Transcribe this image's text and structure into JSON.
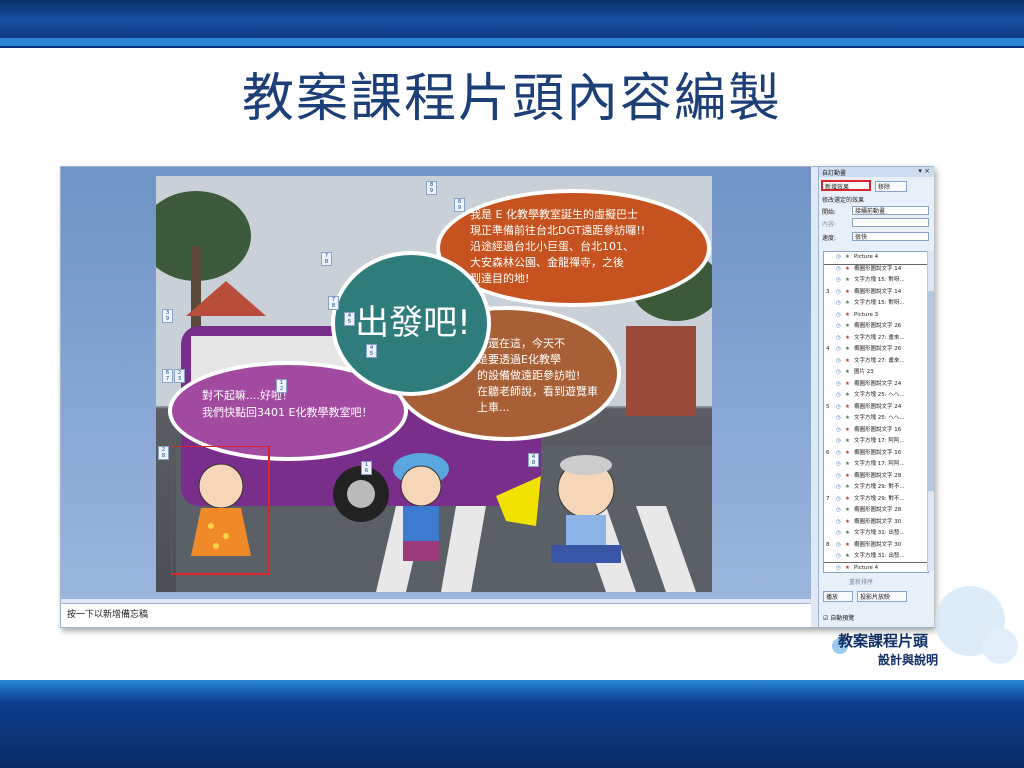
{
  "title": "教案課程片頭內容編製",
  "notes_placeholder": "按一下以新增備忘稿",
  "panel": {
    "header": "自訂動畫",
    "close": "▾ ×",
    "add_effect": "新增效果",
    "remove": "移除",
    "section": "修改選定的效果",
    "start_label": "開始:",
    "start_value": "接續前動畫",
    "prop_label": "內容:",
    "speed_label": "速度:",
    "speed_value": "很快",
    "reorder": "重新排序",
    "play": "播放",
    "slideshow": "投影片放映",
    "autopreview": "自動預覽",
    "items": [
      {
        "n": "",
        "t": "Picture 4"
      },
      {
        "n": "",
        "t": "橢圓形圖說文字 14"
      },
      {
        "n": "",
        "t": "文字方塊 15: 對呀..."
      },
      {
        "n": "3",
        "t": "橢圓形圖說文字 14"
      },
      {
        "n": "",
        "t": "文字方塊 15: 對呀..."
      },
      {
        "n": "",
        "t": "Picture 3"
      },
      {
        "n": "",
        "t": "橢圓形圖說文字 26"
      },
      {
        "n": "",
        "t": "文字方塊 27: 畫來..."
      },
      {
        "n": "4",
        "t": "橢圓形圖說文字 26"
      },
      {
        "n": "",
        "t": "文字方塊 27: 畫來..."
      },
      {
        "n": "",
        "t": "圖片 23"
      },
      {
        "n": "",
        "t": "橢圓形圖說文字 24"
      },
      {
        "n": "",
        "t": "文字方塊 25: ヘヘ..."
      },
      {
        "n": "5",
        "t": "橢圓形圖說文字 24"
      },
      {
        "n": "",
        "t": "文字方塊 25: ヘヘ..."
      },
      {
        "n": "",
        "t": "橢圓形圖說文字 16"
      },
      {
        "n": "",
        "t": "文字方塊 17: 阿阿..."
      },
      {
        "n": "6",
        "t": "橢圓形圖說文字 16"
      },
      {
        "n": "",
        "t": "文字方塊 17: 阿阿..."
      },
      {
        "n": "",
        "t": "橢圓形圖說文字 28"
      },
      {
        "n": "",
        "t": "文字方塊 29: 對不..."
      },
      {
        "n": "7",
        "t": "文字方塊 29: 對不..."
      },
      {
        "n": "",
        "t": "橢圓形圖說文字 28"
      },
      {
        "n": "",
        "t": "橢圓形圖說文字 30"
      },
      {
        "n": "",
        "t": "文字方塊 31: 出發..."
      },
      {
        "n": "8",
        "t": "橢圓形圖說文字 30"
      },
      {
        "n": "",
        "t": "文字方塊 31: 出發..."
      },
      {
        "n": "",
        "t": "Picture 4"
      }
    ]
  },
  "bubbles": {
    "top": "我是 E 化教學教室誕生的虛擬巴士\n現正準備前往台北DGT遠距參訪囉!!\n沿途經過台北小巨蛋、台北101、\n大安森林公園、金龍禪寺，之後\n到達目的地!",
    "go": "出發吧!",
    "brown": "麼還在這，今天不\n是要透過E化教學\n的設備做遠距參訪啦!\n在聽老師說，看到遊覽車\n上車...",
    "purple": "對不起嘛....好啦！\n我們快點回3401 E化教學教室吧！"
  },
  "logo": {
    "line1": "教案課程片頭",
    "line2": "設計與說明"
  }
}
